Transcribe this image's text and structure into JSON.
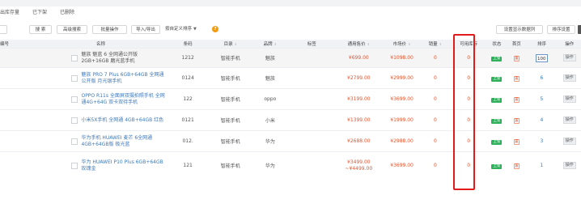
{
  "tabs": [
    "出库存量",
    "已下架",
    "已删除"
  ],
  "toolbar": {
    "search": "搜 索",
    "advanced": "高级搜索",
    "batch": "批量操作",
    "import_export": "导入/导出",
    "sort_select": "按自定义排序",
    "help": "?",
    "display_fields": "设置显示数据列",
    "sort_settings": "排序设置"
  },
  "columns": [
    "编号",
    "名称",
    "条码",
    "目录",
    "品牌",
    "标签",
    "通用售价",
    "市场价",
    "销量",
    "可用库存",
    "状态",
    "首页",
    "排序",
    "操作"
  ],
  "rows": [
    {
      "name": "魅族 魅蓝 6 全网通公开版 2GB+16GB 磨光蓝手机",
      "barcode": "1212",
      "category": "智能手机",
      "brand": "魅族",
      "price": "¥699.00",
      "market": "¥1098.00",
      "sales": "0",
      "stock": "0",
      "status": "上架",
      "home": "置",
      "sort": "100",
      "op": "操作"
    },
    {
      "name": "魅族 PRO 7 Plus 6GB+64GB 全网通公开版 月光银手机",
      "barcode": "0124",
      "category": "智能手机",
      "brand": "魅族",
      "price": "¥2799.00",
      "market": "¥2999.00",
      "sales": "0",
      "stock": "0",
      "status": "上架",
      "home": "置",
      "sort": "6",
      "op": "操作"
    },
    {
      "name": "OPPO R11s 全面屏双摄拍照手机 全网通4G+64G 双卡双待手机",
      "barcode": "122",
      "category": "智能手机",
      "brand": "oppo",
      "price": "¥3199.00",
      "market": "¥3699.00",
      "sales": "0",
      "stock": "0",
      "status": "上架",
      "home": "置",
      "sort": "5",
      "op": "操作"
    },
    {
      "name": "小米5X手机 全网通 4GB+64GB 红色",
      "barcode": "0121",
      "category": "智能手机",
      "brand": "小米",
      "price": "¥1399.00",
      "market": "¥1999.00",
      "sales": "0",
      "stock": "0",
      "status": "上架",
      "home": "置",
      "sort": "4",
      "op": "操作"
    },
    {
      "name": "华为手机 HUAWEI 麦芒 6全网通 4GB+64GB版 极光蓝",
      "barcode": "012.",
      "category": "智能手机",
      "brand": "华为",
      "price": "¥2688.00",
      "market": "¥2988.00",
      "sales": "0",
      "stock": "0",
      "status": "上架",
      "home": "置",
      "sort": "3",
      "op": "操作"
    },
    {
      "name": "华为 HUAWEI P10 Plus 6GB+64GB 玫瑰金",
      "barcode": "121",
      "category": "智能手机",
      "brand": "华为",
      "price": "¥3499.00 ~¥4499.00",
      "market": "¥3699.00",
      "sales": "0",
      "stock": "0",
      "status": "上架",
      "home": "置",
      "sort": "1",
      "op": "操作"
    }
  ],
  "colors": {
    "accent": "#3b7bbf",
    "price": "#e8542d",
    "on": "#2fb15c",
    "highlight": "#e11a1a"
  }
}
